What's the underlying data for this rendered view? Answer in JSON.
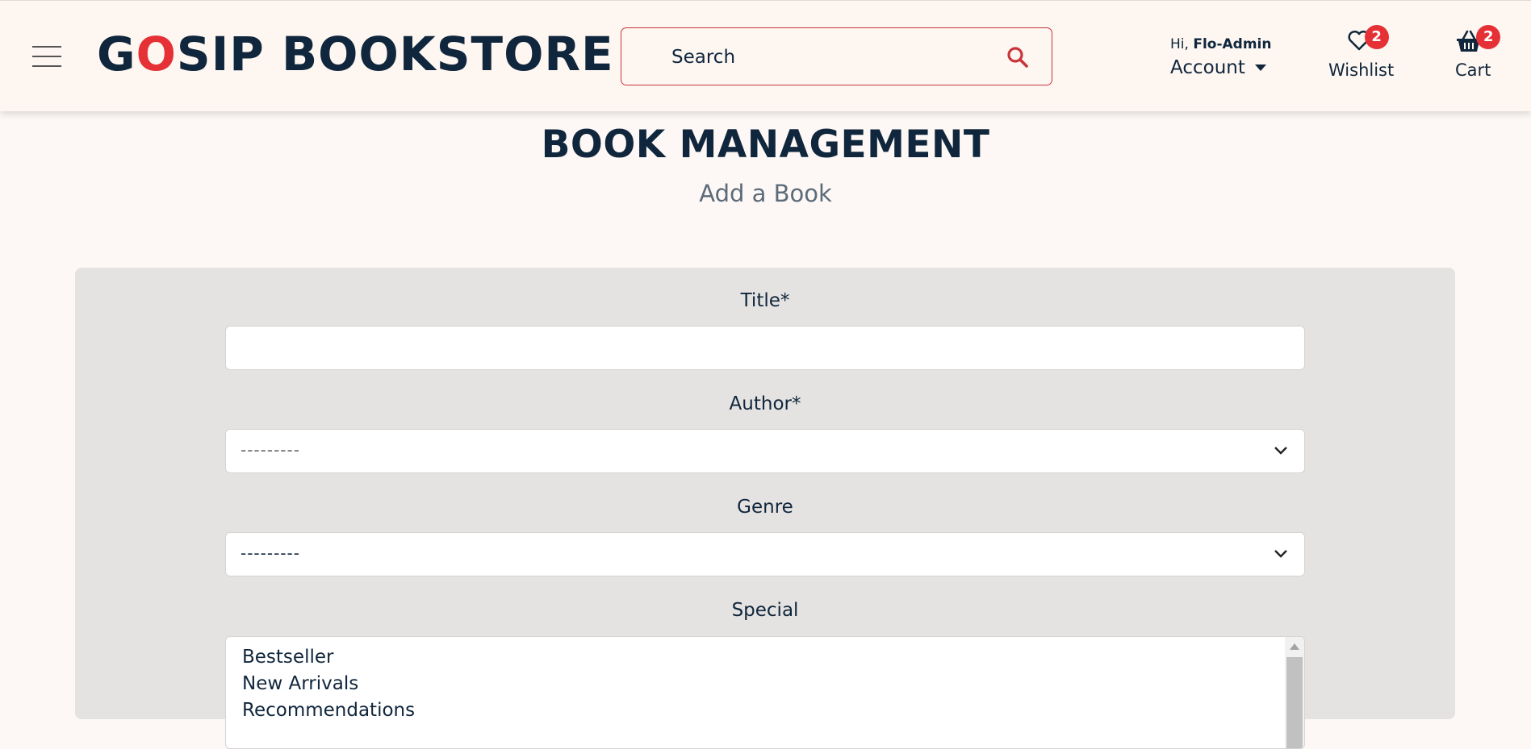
{
  "header": {
    "logo": {
      "g": "G",
      "o": "O",
      "rest": "SIP BOOKSTORE"
    },
    "search": {
      "placeholder": "Search"
    },
    "account": {
      "greeting": "Hi, ",
      "username": "Flo-Admin",
      "label": "Account"
    },
    "wishlist": {
      "label": "Wishlist",
      "count": "2"
    },
    "cart": {
      "label": "Cart",
      "count": "2"
    }
  },
  "page": {
    "title": "BOOK MANAGEMENT",
    "subtitle": "Add a Book"
  },
  "form": {
    "title": {
      "label": "Title*",
      "value": ""
    },
    "author": {
      "label": "Author*",
      "selected": "---------"
    },
    "genre": {
      "label": "Genre",
      "selected": "---------"
    },
    "special": {
      "label": "Special",
      "options": [
        "Bestseller",
        "New Arrivals",
        "Recommendations"
      ]
    }
  },
  "colors": {
    "brand_red": "#e53135",
    "navy": "#10263c",
    "panel": "#e5e3e2",
    "background": "#fdf8f5"
  }
}
